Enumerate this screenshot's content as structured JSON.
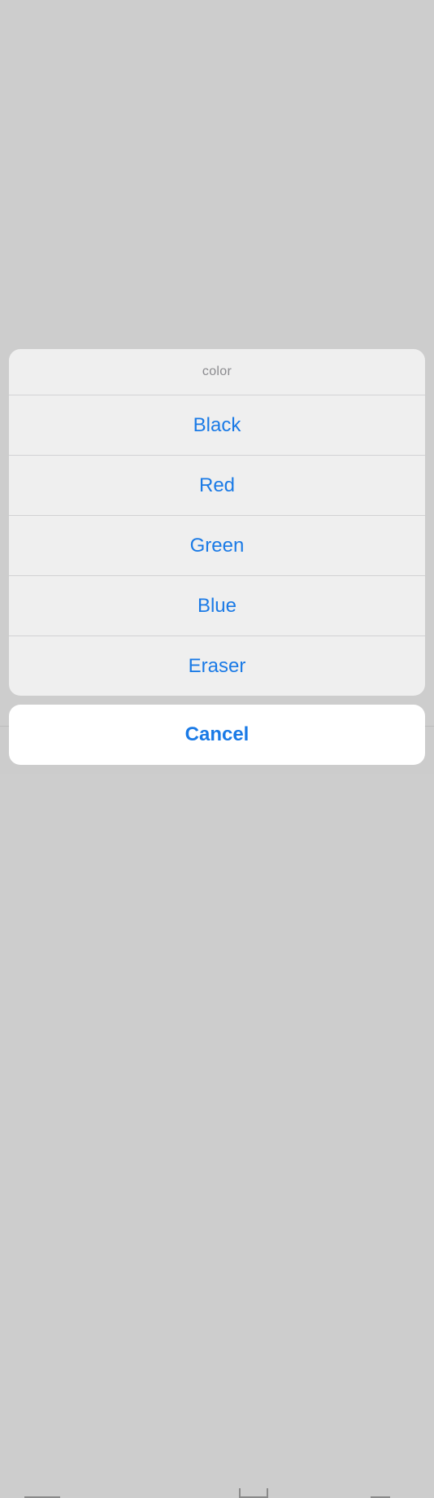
{
  "action_sheet": {
    "title": "color",
    "items": [
      {
        "label": "Black"
      },
      {
        "label": "Red"
      },
      {
        "label": "Green"
      },
      {
        "label": "Blue"
      },
      {
        "label": "Eraser"
      }
    ],
    "cancel_label": "Cancel"
  },
  "colors": {
    "accent": "#1a7ae6",
    "dimmed_background": "#cdcdcd",
    "sheet_background": "#efefef",
    "title_text": "#8a8a8e"
  }
}
